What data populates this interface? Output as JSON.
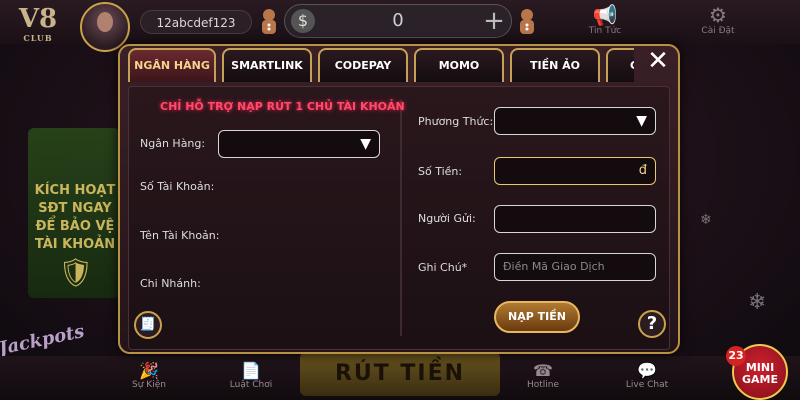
{
  "header": {
    "logo": "V8",
    "logo_sub": "CLUB",
    "username": "12abcdef123",
    "balance": "0",
    "news_label": "Tin Tức",
    "settings_label": "Cài Đặt"
  },
  "promo": {
    "text": "KÍCH HOẠT SĐT NGAY ĐỂ BẢO VỆ TÀI KHOẢN"
  },
  "dialog": {
    "tabs": [
      {
        "label": "NGÂN HÀNG",
        "active": true
      },
      {
        "label": "SMARTLINK",
        "active": false
      },
      {
        "label": "CODEPAY",
        "active": false
      },
      {
        "label": "MOMO",
        "active": false
      },
      {
        "label": "TIỀN ẢO",
        "active": false
      },
      {
        "label": "G",
        "active": false
      }
    ],
    "notice": "CHỈ HỖ TRỢ NẠP RÚT 1 CHỦ TÀI KHOẢN",
    "left_form": {
      "bank_label": "Ngân Hàng:",
      "account_number_label": "Số Tài Khoản:",
      "account_name_label": "Tên Tài Khoản:",
      "branch_label": "Chi Nhánh:"
    },
    "right_form": {
      "method_label": "Phương Thức:",
      "amount_label": "Số Tiền:",
      "amount_suffix": "đ",
      "sender_label": "Người Gửi:",
      "note_label": "Ghi Chú*",
      "note_placeholder": "Điền Mã Giao Dịch"
    },
    "submit_label": "NẠP TIỀN",
    "help_label": "?"
  },
  "bottom_nav": {
    "items": [
      "Sự Kiện",
      "Luật Chơi",
      "Hotline",
      "Live Chat"
    ],
    "center_banner": "RÚT TIỀN"
  },
  "mini_game": {
    "label": "MINI GAME",
    "count": "23"
  },
  "colors": {
    "gold_border": "#c3a258",
    "notice_pink": "#ff4a6a",
    "active_tab": "#6a2a30"
  }
}
